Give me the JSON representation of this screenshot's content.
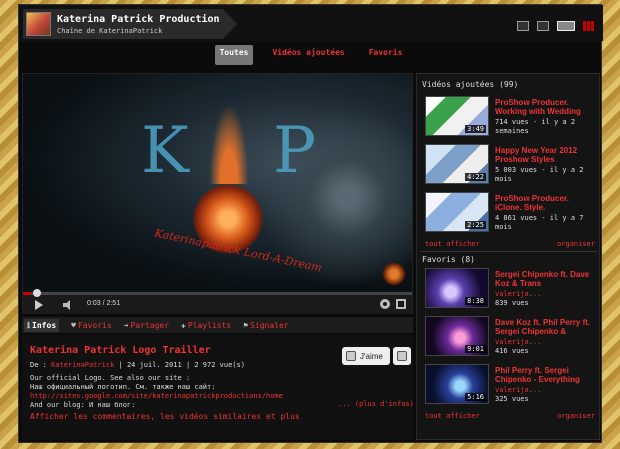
{
  "channel": {
    "title": "Katerina Patrick Production",
    "subtitle": "Chaîne de KaterinaPatrick"
  },
  "tabs": [
    {
      "label": "Toutes",
      "active": true
    },
    {
      "label": "Vidéos ajoutées",
      "active": false
    },
    {
      "label": "Favoris",
      "active": false
    }
  ],
  "player": {
    "time": "0:03 / 2:51",
    "progress": 0.02,
    "overlay_script": "Katerinapatrick Lord-A-Dream"
  },
  "actions": {
    "infos": "Infos",
    "favoris": "Favoris",
    "partager": "Partager",
    "playlists": "Playlists",
    "signaler": "Signaler"
  },
  "video": {
    "title": "Katerina Patrick Logo Trailler",
    "meta_prefix": "De :",
    "author": "KaterinaPatrick",
    "date": "| 24 juil. 2011",
    "views": "| 2 972 vue(s)",
    "desc_line1": "Our official Logo. See also our site :",
    "desc_line2": "Наш официальный логотип. См. также наш сайт:",
    "desc_link": "http://sites.google.com/site/katerinapatrickproductions/home",
    "desc_line3": "And our blog: И наш блог:",
    "more": "... (plus d'infos)",
    "show_all": "Afficher les commentaires, les vidéos similaires et plus",
    "like_label": "J'aime"
  },
  "sidebar": {
    "added_title": "Vidéos ajoutées (99)",
    "added": [
      {
        "title": "ProShow Producer. Working with Wedding",
        "meta": "714 vues - il y a 2 semaines",
        "duration": "3:49"
      },
      {
        "title": "Happy New Year 2012 Proshow Styles",
        "meta": "5 003 vues - il y a 2 mois",
        "duration": "4:22"
      },
      {
        "title": "ProShow Producer. iClone. Style.",
        "meta": "4 861 vues - il y a 7 mois",
        "duration": "2:25"
      }
    ],
    "show_all": "tout afficher",
    "organize": "organiser",
    "fav_title": "Favoris (8)",
    "favorites": [
      {
        "title": "Sergei Chipenko ft. Dave Koz & Trans",
        "user": "valerija...",
        "views": "839 vues",
        "duration": "8:38"
      },
      {
        "title": "Dave Koz ft. Phil Perry ft. Sergei Chipenko &",
        "user": "valerija...",
        "views": "416 vues",
        "duration": "9:01"
      },
      {
        "title": "Phil Perry ft. Sergei Chipenko - Everything",
        "user": "valerija...",
        "views": "325 vues",
        "duration": "5:16"
      }
    ]
  },
  "colors": {
    "accent": "#ee3333",
    "background": "#0b0b0b",
    "frame": "#c9a24a"
  }
}
